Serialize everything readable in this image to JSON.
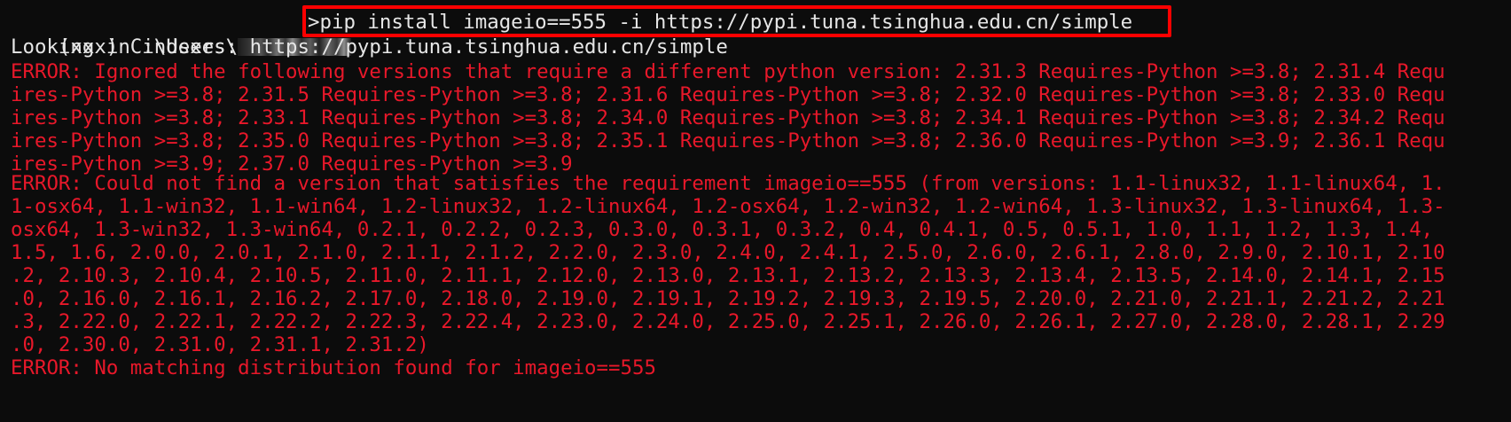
{
  "terminal": {
    "prompt": "(xxx) C:\\Users\\",
    "prompt_suffix": ">",
    "command": "pip install imageio==555 -i https://pypi.tuna.tsinghua.edu.cn/simple",
    "info": "Looking in indexes: https://pypi.tuna.tsinghua.edu.cn/simple",
    "error_lines": [
      "ERROR: Ignored the following versions that require a different python version: 2.31.3 Requires-Python >=3.8; 2.31.4 Requ",
      "ires-Python >=3.8; 2.31.5 Requires-Python >=3.8; 2.31.6 Requires-Python >=3.8; 2.32.0 Requires-Python >=3.8; 2.33.0 Requ",
      "ires-Python >=3.8; 2.33.1 Requires-Python >=3.8; 2.34.0 Requires-Python >=3.8; 2.34.1 Requires-Python >=3.8; 2.34.2 Requ",
      "ires-Python >=3.8; 2.35.0 Requires-Python >=3.8; 2.35.1 Requires-Python >=3.8; 2.36.0 Requires-Python >=3.9; 2.36.1 Requ",
      "ires-Python >=3.9; 2.37.0 Requires-Python >=3.9",
      "ERROR: Could not find a version that satisfies the requirement imageio==555 (from versions: 1.1-linux32, 1.1-linux64, 1.",
      "1-osx64, 1.1-win32, 1.1-win64, 1.2-linux32, 1.2-linux64, 1.2-osx64, 1.2-win32, 1.2-win64, 1.3-linux32, 1.3-linux64, 1.3-",
      "osx64, 1.3-win32, 1.3-win64, 0.2.1, 0.2.2, 0.2.3, 0.3.0, 0.3.1, 0.3.2, 0.4, 0.4.1, 0.5, 0.5.1, 1.0, 1.1, 1.2, 1.3, 1.4,",
      "1.5, 1.6, 2.0.0, 2.0.1, 2.1.0, 2.1.1, 2.1.2, 2.2.0, 2.3.0, 2.4.0, 2.4.1, 2.5.0, 2.6.0, 2.6.1, 2.8.0, 2.9.0, 2.10.1, 2.10",
      ".2, 2.10.3, 2.10.4, 2.10.5, 2.11.0, 2.11.1, 2.12.0, 2.13.0, 2.13.1, 2.13.2, 2.13.3, 2.13.4, 2.13.5, 2.14.0, 2.14.1, 2.15",
      ".0, 2.16.0, 2.16.1, 2.16.2, 2.17.0, 2.18.0, 2.19.0, 2.19.1, 2.19.2, 2.19.3, 2.19.5, 2.20.0, 2.21.0, 2.21.1, 2.21.2, 2.21",
      ".3, 2.22.0, 2.22.1, 2.22.2, 2.22.3, 2.22.4, 2.23.0, 2.24.0, 2.25.0, 2.25.1, 2.26.0, 2.26.1, 2.27.0, 2.28.0, 2.28.1, 2.29",
      ".0, 2.30.0, 2.31.0, 2.31.1, 2.31.2)",
      "ERROR: No matching distribution found for imageio==555"
    ]
  },
  "colors": {
    "background": "#0c0c0c",
    "text": "#e6e6e6",
    "error": "#e8182a",
    "highlight_border": "#ff0000"
  }
}
